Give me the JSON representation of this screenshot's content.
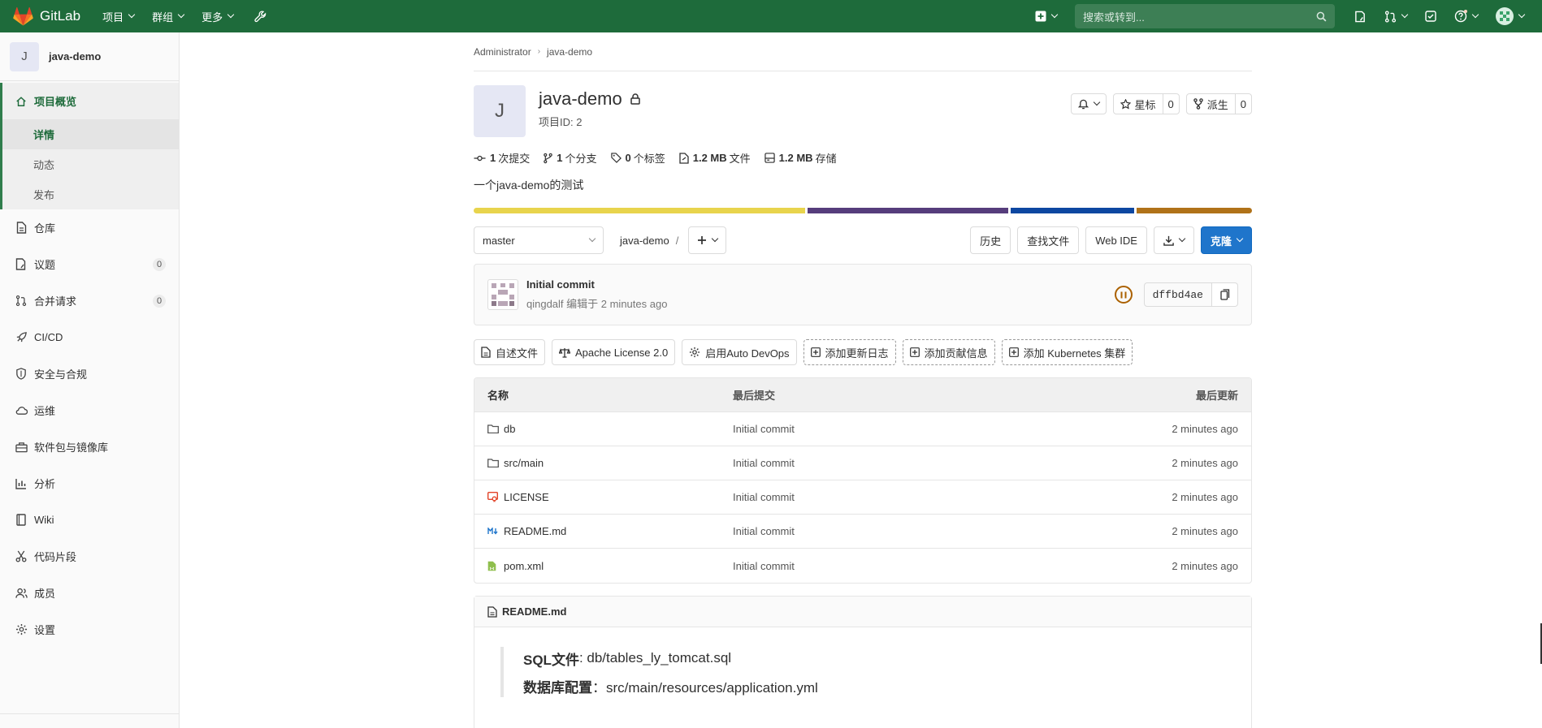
{
  "topbar": {
    "brand": "GitLab",
    "menus": [
      "项目",
      "群组",
      "更多"
    ],
    "search_placeholder": "搜索或转到..."
  },
  "sidebar": {
    "project_initial": "J",
    "project_name": "java-demo",
    "overview_label": "项目概览",
    "overview_sub": [
      "详情",
      "动态",
      "发布"
    ],
    "items": [
      {
        "label": "仓库",
        "icon": "document-icon"
      },
      {
        "label": "议题",
        "icon": "issues-icon",
        "badge": "0"
      },
      {
        "label": "合并请求",
        "icon": "merge-request-icon",
        "badge": "0"
      },
      {
        "label": "CI/CD",
        "icon": "rocket-icon"
      },
      {
        "label": "安全与合规",
        "icon": "shield-icon"
      },
      {
        "label": "运维",
        "icon": "cloud-gear-icon"
      },
      {
        "label": "软件包与镜像库",
        "icon": "package-icon"
      },
      {
        "label": "分析",
        "icon": "chart-icon"
      },
      {
        "label": "Wiki",
        "icon": "book-icon"
      },
      {
        "label": "代码片段",
        "icon": "scissors-icon"
      },
      {
        "label": "成员",
        "icon": "users-icon"
      },
      {
        "label": "设置",
        "icon": "settings-icon"
      }
    ]
  },
  "breadcrumb": [
    "Administrator",
    "java-demo"
  ],
  "project": {
    "initial": "J",
    "title": "java-demo",
    "id_text": "项目ID: 2",
    "star_label": "星标",
    "star_count": "0",
    "fork_label": "派生",
    "fork_count": "0",
    "description": "一个java-demo的测试"
  },
  "stats": [
    {
      "value": "1",
      "label": "次提交"
    },
    {
      "value": "1",
      "label": "个分支"
    },
    {
      "value": "0",
      "label": "个标签"
    },
    {
      "value": "1.2 MB",
      "label": "文件"
    },
    {
      "value": "1.2 MB",
      "label": "存储"
    }
  ],
  "language_bar": [
    {
      "color": "#e8d44d",
      "share": 43
    },
    {
      "color": "#563d7c",
      "share": 26
    },
    {
      "color": "#0d47a1",
      "share": 16
    },
    {
      "color": "#b07219",
      "share": 15
    }
  ],
  "toolbar": {
    "branch": "master",
    "path": "java-demo",
    "path_sep": "/",
    "history": "历史",
    "find_file": "查找文件",
    "web_ide": "Web IDE",
    "clone": "克隆"
  },
  "commit": {
    "title": "Initial commit",
    "meta": "qingdalf 编辑于 2 minutes ago",
    "sha": "dffbd4ae"
  },
  "quick_actions": [
    {
      "label": "自述文件",
      "icon": "document-icon",
      "dashed": false
    },
    {
      "label": "Apache License 2.0",
      "icon": "scale-icon",
      "dashed": false
    },
    {
      "label": "启用Auto DevOps",
      "icon": "gear-icon",
      "dashed": false
    },
    {
      "label": "添加更新日志",
      "icon": "plus-square-icon",
      "dashed": true
    },
    {
      "label": "添加贡献信息",
      "icon": "plus-square-icon",
      "dashed": true
    },
    {
      "label": "添加 Kubernetes 集群",
      "icon": "plus-square-icon",
      "dashed": true
    }
  ],
  "file_table": {
    "headers": [
      "名称",
      "最后提交",
      "最后更新"
    ],
    "rows": [
      {
        "name": "db",
        "icon": "folder-icon",
        "commit": "Initial commit",
        "updated": "2 minutes ago"
      },
      {
        "name": "src/main",
        "icon": "folder-icon",
        "commit": "Initial commit",
        "updated": "2 minutes ago"
      },
      {
        "name": "LICENSE",
        "icon": "license-icon",
        "commit": "Initial commit",
        "updated": "2 minutes ago"
      },
      {
        "name": "README.md",
        "icon": "markdown-icon",
        "commit": "Initial commit",
        "updated": "2 minutes ago"
      },
      {
        "name": "pom.xml",
        "icon": "xml-file-icon",
        "commit": "Initial commit",
        "updated": "2 minutes ago"
      }
    ]
  },
  "readme": {
    "filename": "README.md",
    "lines": [
      {
        "key": "SQL文件",
        "value": ": db/tables_ly_tomcat.sql"
      },
      {
        "key": "数据库配置",
        "value": "：src/main/resources/application.yml"
      }
    ]
  }
}
